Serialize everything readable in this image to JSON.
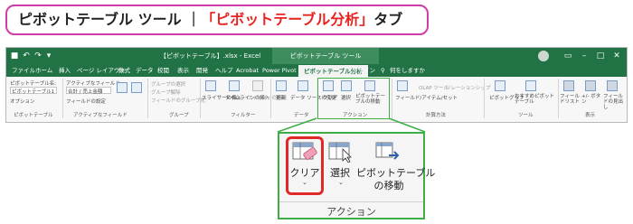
{
  "heading": {
    "prefix": "ピボットテーブル ツール ｜",
    "highlight": "「ピボットテーブル分析」",
    "suffix": "タブ"
  },
  "window": {
    "title": "【ピボットテーブル】.xlsx - Excel",
    "context_tools": "ピボットテーブル ツール"
  },
  "tabs": [
    "ファイル",
    "ホーム",
    "挿入",
    "ページ レイアウト",
    "数式",
    "データ",
    "校閲",
    "表示",
    "開発",
    "ヘルプ",
    "Acrobat",
    "Power Pivot",
    "ピボットテーブル分析",
    "デザイン"
  ],
  "tell_me": "何をしますか",
  "ribbon": {
    "pivot_name_label": "ピボットテーブル名:",
    "pivot_name_value": "ピボットテーブル1",
    "options_label": "オプション",
    "active_field_label": "アクティブなフィールド:",
    "active_field_value": "合計 / 売上金額",
    "field_settings_label": "フィールドの設定",
    "group_items": [
      "グループの選択",
      "グループ解除",
      "フィールドのグループ化"
    ],
    "filter_items": [
      "スライサーの挿入",
      "タイムラインの挿入",
      "フィルターの接続"
    ],
    "data_items": [
      "更新",
      "データ ソースの変更"
    ],
    "action_items": [
      "クリア",
      "選択",
      "ピボットテーブルの移動"
    ],
    "calc_items": [
      "フィールド/アイテム/セット",
      "OLAP ツール",
      "リレーションシップ"
    ],
    "tool_items": [
      "ピボットグラフ",
      "おすすめピボットテーブル"
    ],
    "show_items": [
      "フィールドリスト",
      "+/- ボタン",
      "フィールドの見出し"
    ],
    "groups": [
      "ピボットテーブル",
      "アクティブなフィールド",
      "グループ",
      "フィルター",
      "データ",
      "アクション",
      "計算方法",
      "ツール",
      "表示"
    ]
  },
  "zoom": {
    "clear_label": "クリア",
    "select_label": "選択",
    "move_label_line1": "ピボットテーブル",
    "move_label_line2": "の移動",
    "group_label": "アクション"
  },
  "colors": {
    "excel_green": "#217346",
    "highlight_red": "#e8231f",
    "banner_border": "#d23ca6",
    "callout_green": "#3fae49"
  }
}
